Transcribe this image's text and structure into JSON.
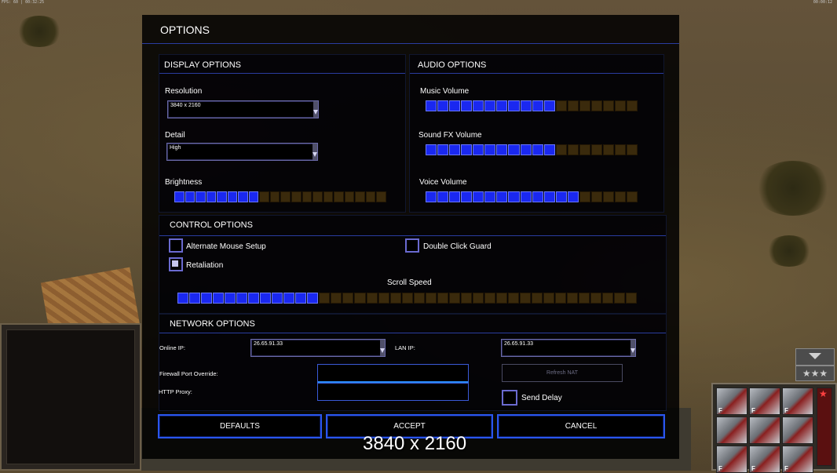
{
  "hud": {
    "top_left_text": "FPS: 60 | 00:32:25",
    "top_right_text": "00:00:12"
  },
  "options": {
    "title": "OPTIONS",
    "display": {
      "heading": "DISPLAY OPTIONS",
      "resolution_label": "Resolution",
      "resolution_value": "3840 x 2160",
      "detail_label": "Detail",
      "detail_value": "High",
      "brightness_label": "Brightness",
      "brightness_level": 8,
      "brightness_max": 20
    },
    "audio": {
      "heading": "AUDIO OPTIONS",
      "music_label": "Music Volume",
      "music_level": 11,
      "music_max": 18,
      "sfx_label": "Sound FX Volume",
      "sfx_level": 11,
      "sfx_max": 18,
      "voice_label": "Voice Volume",
      "voice_level": 13,
      "voice_max": 18
    },
    "control": {
      "heading": "CONTROL OPTIONS",
      "alt_mouse_label": "Alternate Mouse Setup",
      "alt_mouse_checked": false,
      "double_click_label": "Double Click Guard",
      "double_click_checked": false,
      "retaliation_label": "Retaliation",
      "retaliation_checked": true,
      "scroll_label": "Scroll Speed",
      "scroll_level": 12,
      "scroll_max": 39
    },
    "network": {
      "heading": "NETWORK OPTIONS",
      "online_ip_label": "Online IP:",
      "online_ip_value": "26.65.91.33",
      "lan_ip_label": "LAN IP:",
      "lan_ip_value": "26.65.91.33",
      "firewall_label": "Firewall Port Override:",
      "firewall_value": "",
      "proxy_label": "HTTP Proxy:",
      "proxy_value": "",
      "refresh_label": "Refresh NAT",
      "send_delay_label": "Send Delay",
      "send_delay_checked": false
    },
    "buttons": {
      "defaults": "DEFAULTS",
      "accept": "ACCEPT",
      "cancel": "CANCEL"
    },
    "overlay_text": "3840 x 2160"
  },
  "unit_panel": {
    "slot_hotkey": "F",
    "stars": "★★★"
  },
  "colors": {
    "slider_on": "#1a28f0",
    "slider_off": "#3a2a0c",
    "accent_blue": "#2a56ee"
  }
}
